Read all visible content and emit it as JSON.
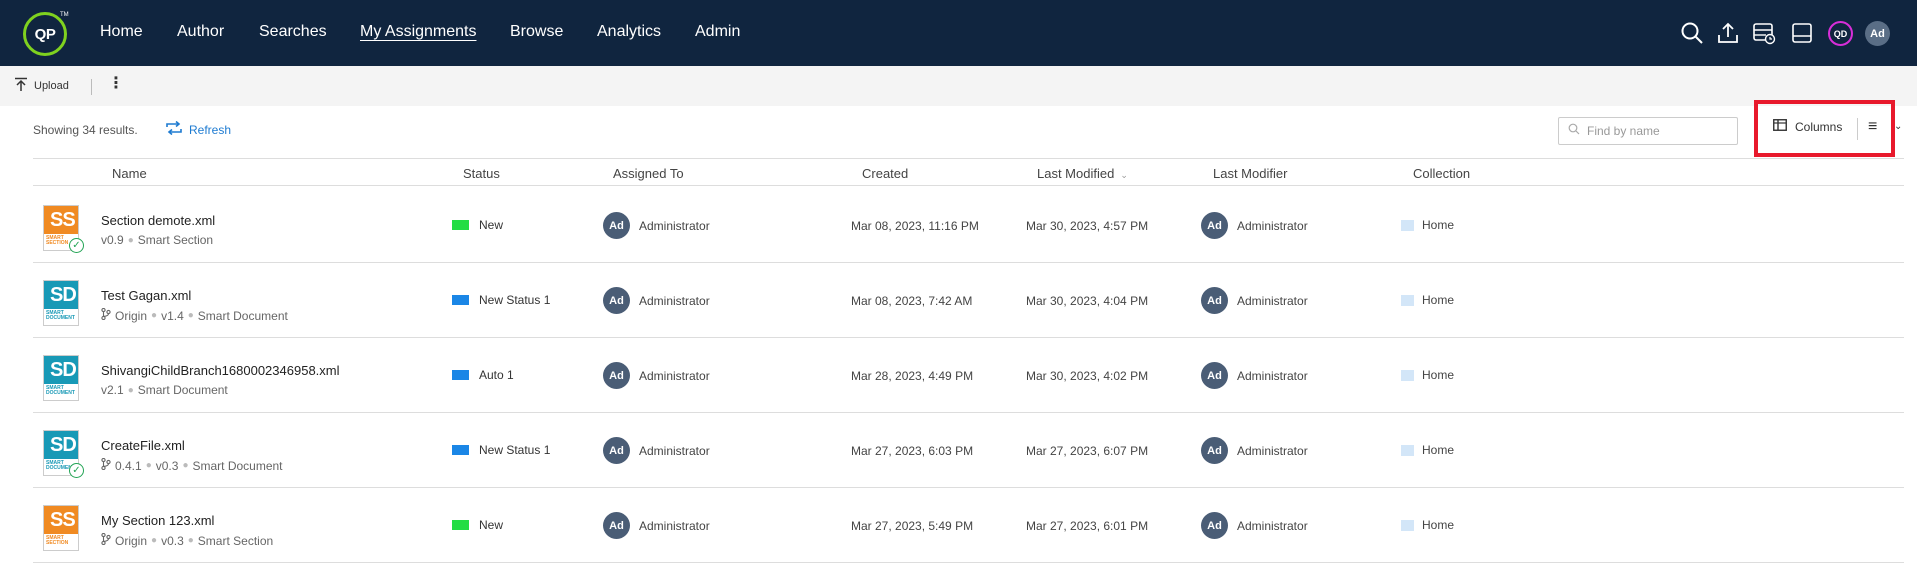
{
  "nav": {
    "logo_text": "QP",
    "logo_tm": "TM",
    "items": [
      "Home",
      "Author",
      "Searches",
      "My Assignments",
      "Browse",
      "Analytics",
      "Admin"
    ],
    "active": "My Assignments",
    "icons": [
      "search-icon",
      "upload-icon",
      "server-clock-icon",
      "drive-icon"
    ],
    "qd_avatar": "QD",
    "user_avatar": "Ad"
  },
  "toolbar": {
    "upload_label": "Upload",
    "more_icon": "more-vertical-icon"
  },
  "results": {
    "count_text": "Showing 34 results.",
    "refresh_label": "Refresh"
  },
  "search": {
    "placeholder": "Find by name"
  },
  "view": {
    "columns_label": "Columns"
  },
  "colors": {
    "navbar": "#10253f",
    "logo_ring": "#7fd21f",
    "accent": "#1e7bd1",
    "highlight": "#e8192c",
    "status_green": "#22dd44",
    "status_blue": "#1a86e6",
    "thumb_orange": "#f08a22",
    "thumb_teal": "#1899b6"
  },
  "table": {
    "headers": {
      "name": "Name",
      "status": "Status",
      "assigned_to": "Assigned To",
      "created": "Created",
      "last_modified": "Last Modified",
      "last_modifier": "Last Modifier",
      "collection": "Collection"
    },
    "rows": [
      {
        "thumb_type": "SS",
        "thumb_sub": "SMART SECTION",
        "thumb_color": "#f08a22",
        "checked": true,
        "name": "Section demote.xml",
        "branch": "",
        "version": "v0.9",
        "kind": "Smart Section",
        "status": "New",
        "status_color": "#22dd44",
        "assigned_initials": "Ad",
        "assigned": "Administrator",
        "created": "Mar 08, 2023, 11:16 PM",
        "modified": "Mar 30, 2023, 4:57 PM",
        "modifier_initials": "Ad",
        "modifier": "Administrator",
        "collection": "Home"
      },
      {
        "thumb_type": "SD",
        "thumb_sub": "SMART DOCUMENT",
        "thumb_color": "#1899b6",
        "checked": false,
        "name": "Test Gagan.xml",
        "branch": "Origin",
        "version": "v1.4",
        "kind": "Smart Document",
        "status": "New Status 1",
        "status_color": "#1a86e6",
        "assigned_initials": "Ad",
        "assigned": "Administrator",
        "created": "Mar 08, 2023, 7:42 AM",
        "modified": "Mar 30, 2023, 4:04 PM",
        "modifier_initials": "Ad",
        "modifier": "Administrator",
        "collection": "Home"
      },
      {
        "thumb_type": "SD",
        "thumb_sub": "SMART DOCUMENT",
        "thumb_color": "#1899b6",
        "checked": false,
        "name": "ShivangiChildBranch1680002346958.xml",
        "branch": "",
        "version": "v2.1",
        "kind": "Smart Document",
        "status": "Auto 1",
        "status_color": "#1a86e6",
        "assigned_initials": "Ad",
        "assigned": "Administrator",
        "created": "Mar 28, 2023, 4:49 PM",
        "modified": "Mar 30, 2023, 4:02 PM",
        "modifier_initials": "Ad",
        "modifier": "Administrator",
        "collection": "Home"
      },
      {
        "thumb_type": "SD",
        "thumb_sub": "SMART DOCUMENT",
        "thumb_color": "#1899b6",
        "checked": true,
        "name": "CreateFile.xml",
        "branch": "0.4.1",
        "version": "v0.3",
        "kind": "Smart Document",
        "status": "New Status 1",
        "status_color": "#1a86e6",
        "assigned_initials": "Ad",
        "assigned": "Administrator",
        "created": "Mar 27, 2023, 6:03 PM",
        "modified": "Mar 27, 2023, 6:07 PM",
        "modifier_initials": "Ad",
        "modifier": "Administrator",
        "collection": "Home"
      },
      {
        "thumb_type": "SS",
        "thumb_sub": "SMART SECTION",
        "thumb_color": "#f08a22",
        "checked": false,
        "name": "My Section 123.xml",
        "branch": "Origin",
        "version": "v0.3",
        "kind": "Smart Section",
        "status": "New",
        "status_color": "#22dd44",
        "assigned_initials": "Ad",
        "assigned": "Administrator",
        "created": "Mar 27, 2023, 5:49 PM",
        "modified": "Mar 27, 2023, 6:01 PM",
        "modifier_initials": "Ad",
        "modifier": "Administrator",
        "collection": "Home"
      }
    ]
  }
}
